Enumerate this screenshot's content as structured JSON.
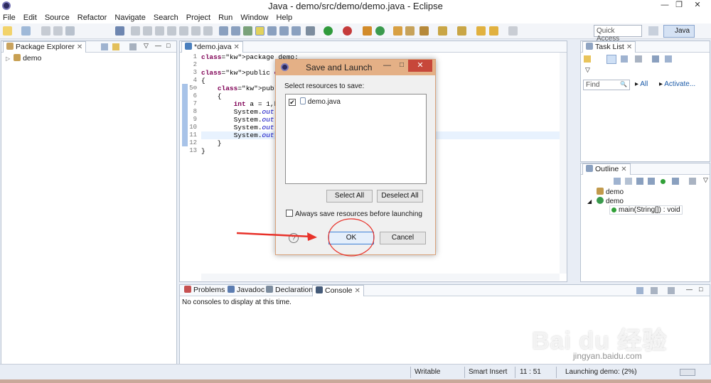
{
  "window": {
    "title": "Java - demo/src/demo/demo.java - Eclipse",
    "min": "—",
    "max": "❐",
    "close": "✕"
  },
  "menu": [
    "File",
    "Edit",
    "Source",
    "Refactor",
    "Navigate",
    "Search",
    "Project",
    "Run",
    "Window",
    "Help"
  ],
  "toolbar": {
    "quick_access": "Quick Access",
    "perspective": "Java"
  },
  "package_explorer": {
    "tab": "Package Explorer",
    "items": [
      {
        "label": "demo"
      }
    ]
  },
  "editor": {
    "tab": "*demo.java",
    "line_numbers": [
      "1",
      "2",
      "3",
      "4",
      "5⊖",
      "6",
      "7",
      "8",
      "9",
      "10",
      "11",
      "12",
      "13"
    ],
    "lines": [
      "package demo;",
      "",
      "public class demo",
      "{",
      "    public static voi",
      "    {",
      "        int a = 1,b =",
      "        System.out.pr",
      "        System.out.pr",
      "        System.out.pr",
      "        System.out.pr",
      "    }",
      "}"
    ]
  },
  "dialog": {
    "title": "Save and Launch",
    "prompt": "Select resources to save:",
    "resources": [
      {
        "label": "demo.java",
        "checked": true
      }
    ],
    "select_all": "Select All",
    "deselect_all": "Deselect All",
    "always_save": "Always save resources before launching",
    "ok": "OK",
    "cancel": "Cancel",
    "help": "?"
  },
  "task_list": {
    "tab": "Task List",
    "find_placeholder": "Find",
    "all": "All",
    "activate": "Activate..."
  },
  "outline": {
    "tab": "Outline",
    "items": [
      {
        "label": "demo"
      },
      {
        "label": "demo"
      },
      {
        "label": "main(String[]) : void"
      }
    ]
  },
  "bottom_panel": {
    "tabs": [
      "Problems",
      "Javadoc",
      "Declaration",
      "Console"
    ],
    "message": "No consoles to display at this time."
  },
  "status": {
    "writable": "Writable",
    "insert_mode": "Smart Insert",
    "position": "11 : 51",
    "launching": "Launching demo: (2%)"
  },
  "watermark": {
    "text": "Bai du 经验",
    "url": "jingyan.baidu.com"
  },
  "colors": {
    "keyword": "#7f0055",
    "dialog_title": "#e4b086",
    "close_red": "#c7473a",
    "arrow": "#e8322a"
  }
}
